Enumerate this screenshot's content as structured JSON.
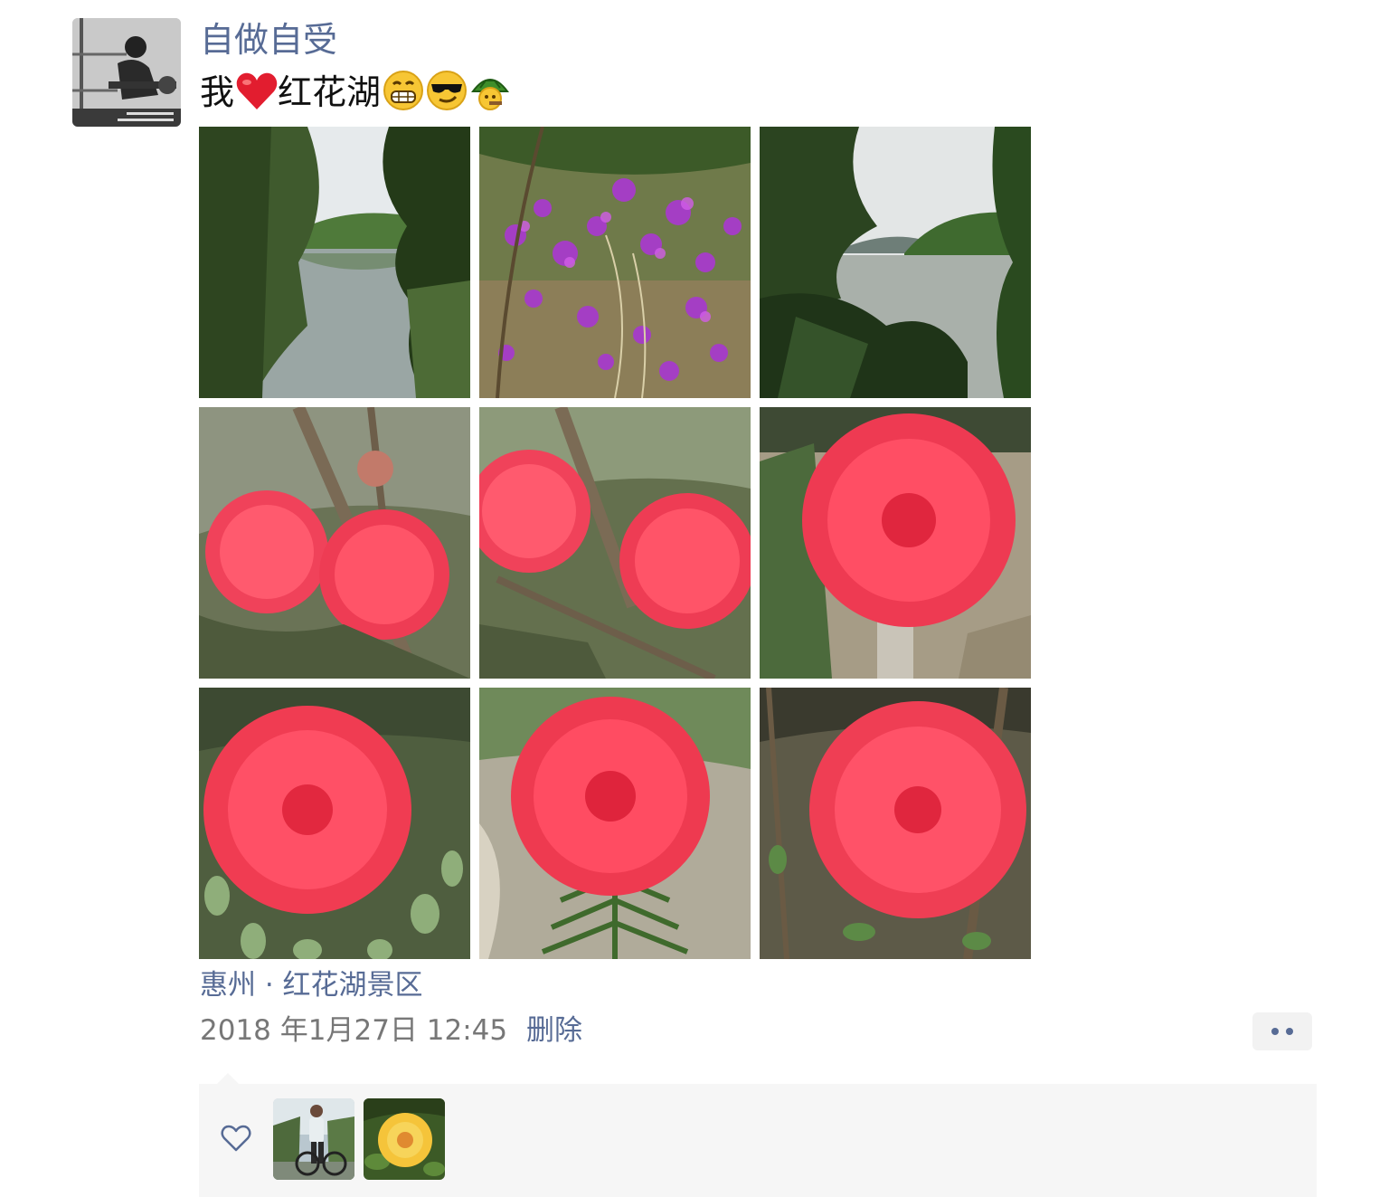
{
  "post": {
    "author": "自做自受",
    "text_prefix": "我",
    "text_place": "红花湖",
    "emojis": [
      "heart-emoji",
      "grin-emoji",
      "sunglasses-emoji",
      "turtle-emoji"
    ],
    "photos": [
      {
        "name": "lake-view-photo"
      },
      {
        "name": "purple-flowers-photo"
      },
      {
        "name": "lake-hills-photo"
      },
      {
        "name": "red-powderpuff-pair-photo"
      },
      {
        "name": "red-powderpuff-closeup-photo"
      },
      {
        "name": "red-powderpuff-large-photo"
      },
      {
        "name": "red-powderpuff-leaves-photo"
      },
      {
        "name": "red-powderpuff-fern-photo"
      },
      {
        "name": "red-powderpuff-branch-photo"
      }
    ],
    "location": "惠州 · 红花湖景区",
    "timestamp": "2018 年1月27日 12:45",
    "delete_label": "删除"
  },
  "likes": {
    "icon": "heart-outline-icon",
    "avatars": [
      "cyclist-avatar",
      "yellow-rose-avatar"
    ]
  },
  "colors": {
    "link": "#576b95",
    "secondary_text": "#777777",
    "panel_bg": "#f6f6f6"
  }
}
